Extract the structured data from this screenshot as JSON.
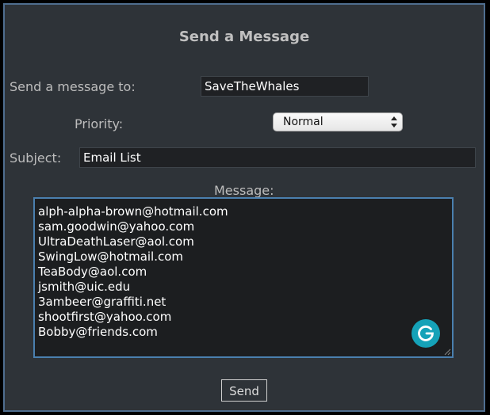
{
  "form": {
    "title": "Send a Message",
    "recipient": {
      "label": "Send a message to:",
      "value": "SaveTheWhales"
    },
    "priority": {
      "label": "Priority:",
      "selected": "Normal"
    },
    "subject": {
      "label": "Subject:",
      "value": "Email List"
    },
    "message": {
      "label": "Message:",
      "lines": [
        "alph-alpha-brown@hotmail.com",
        "sam.goodwin@yahoo.com",
        "UltraDeathLaser@aol.com",
        "SwingLow@hotmail.com",
        "TeaBody@aol.com",
        "jsmith@uic.edu",
        "3ambeer@graffiti.net",
        "shootfirst@yahoo.com",
        "Bobby@friends.com"
      ]
    },
    "send_label": "Send"
  },
  "icons": {
    "grammarly": "grammarly-icon",
    "select_arrows": "up-down-arrows-icon",
    "resize": "resize-grip-icon"
  },
  "colors": {
    "panel_background": "#2e3338",
    "panel_border": "#4f6e8f",
    "textarea_border": "#4a7fae",
    "grammarly": "#15a2b8"
  }
}
